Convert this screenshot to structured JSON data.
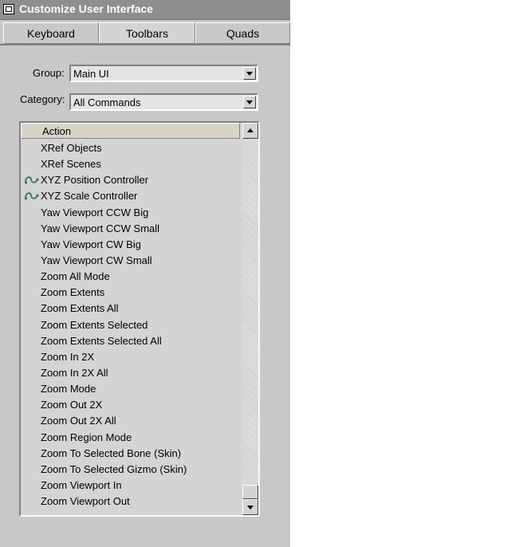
{
  "window": {
    "title": "Customize User Interface",
    "icon": "app-logo-icon"
  },
  "tabs": [
    {
      "label": "Keyboard",
      "active": false
    },
    {
      "label": "Toolbars",
      "active": true
    },
    {
      "label": "Quads",
      "active": false
    }
  ],
  "group": {
    "label": "Group:",
    "value": "Main UI"
  },
  "category": {
    "label": "Category:",
    "value": "All Commands"
  },
  "list": {
    "header": "Action",
    "rows": [
      {
        "text": "XRef Objects",
        "icon": ""
      },
      {
        "text": "XRef Scenes",
        "icon": ""
      },
      {
        "text": "XYZ Position Controller",
        "icon": "controller-curve-icon"
      },
      {
        "text": "XYZ Scale Controller",
        "icon": "controller-curve-icon"
      },
      {
        "text": "Yaw Viewport CCW Big",
        "icon": ""
      },
      {
        "text": "Yaw Viewport CCW Small",
        "icon": ""
      },
      {
        "text": "Yaw Viewport CW Big",
        "icon": ""
      },
      {
        "text": "Yaw Viewport CW Small",
        "icon": ""
      },
      {
        "text": "Zoom All Mode",
        "icon": ""
      },
      {
        "text": "Zoom Extents",
        "icon": ""
      },
      {
        "text": "Zoom Extents All",
        "icon": ""
      },
      {
        "text": "Zoom Extents Selected",
        "icon": ""
      },
      {
        "text": "Zoom Extents Selected All",
        "icon": ""
      },
      {
        "text": "Zoom In 2X",
        "icon": ""
      },
      {
        "text": "Zoom In 2X All",
        "icon": ""
      },
      {
        "text": "Zoom Mode",
        "icon": ""
      },
      {
        "text": "Zoom Out 2X",
        "icon": ""
      },
      {
        "text": "Zoom Out 2X All",
        "icon": ""
      },
      {
        "text": "Zoom Region Mode",
        "icon": ""
      },
      {
        "text": "Zoom To Selected Bone (Skin)",
        "icon": ""
      },
      {
        "text": "Zoom To Selected Gizmo (Skin)",
        "icon": ""
      },
      {
        "text": "Zoom Viewport In",
        "icon": ""
      },
      {
        "text": "Zoom Viewport Out",
        "icon": ""
      }
    ],
    "scroll_position": 1.0
  },
  "colors": {
    "panel": "#c8c8c8",
    "titlebar": "#8e8e8e",
    "icon_green": "#2e8b57"
  }
}
